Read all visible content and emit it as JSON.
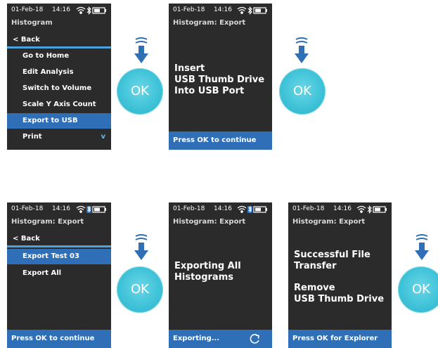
{
  "status": {
    "date": "01-Feb-18",
    "time": "14:16"
  },
  "screen1": {
    "title": "Histogram",
    "back": "< Back",
    "items": [
      "Go to Home",
      "Edit Analysis",
      "Switch to Volume",
      "Scale Y Axis Count",
      "Export to USB",
      "Print"
    ],
    "more_glyph": "v"
  },
  "screen2": {
    "title": "Histogram: Export",
    "message": "Insert\nUSB Thumb Drive\nInto USB Port",
    "footer": "Press OK to continue"
  },
  "screen3": {
    "title": "Histogram: Export",
    "back": "< Back",
    "items": [
      "Export Test 03",
      "Export All"
    ],
    "footer": "Press OK to continue"
  },
  "screen4": {
    "title": "Histogram: Export",
    "message": "Exporting All\nHistograms",
    "footer": "Exporting..."
  },
  "screen5": {
    "title": "Histogram: Export",
    "message1": "Successful File\nTransfer",
    "message2": "Remove\nUSB Thumb Drive",
    "footer": "Press OK for Explorer"
  },
  "ok_label": "OK",
  "colors": {
    "screen_bg": "#2b2b2b",
    "highlight": "#2f6fb8",
    "accent": "#4aa3df",
    "ok_button": "#3cc1d7"
  }
}
